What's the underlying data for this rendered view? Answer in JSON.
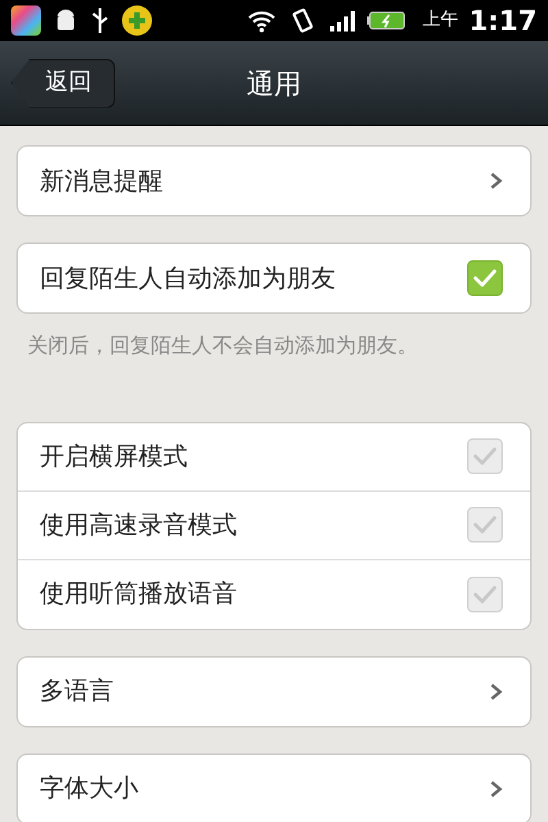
{
  "status_bar": {
    "time_period": "上午",
    "time": "1:17"
  },
  "nav_bar": {
    "back": "返回",
    "title": "通用"
  },
  "groups": [
    {
      "rows": [
        {
          "kind": "link",
          "label": "新消息提醒"
        }
      ]
    },
    {
      "rows": [
        {
          "kind": "checkbox",
          "label": "回复陌生人自动添加为朋友",
          "checked": true
        }
      ],
      "note": "关闭后，回复陌生人不会自动添加为朋友。"
    },
    {
      "rows": [
        {
          "kind": "checkbox",
          "label": "开启横屏模式",
          "checked": false
        },
        {
          "kind": "checkbox",
          "label": "使用高速录音模式",
          "checked": false
        },
        {
          "kind": "checkbox",
          "label": "使用听筒播放语音",
          "checked": false
        }
      ]
    },
    {
      "rows": [
        {
          "kind": "link",
          "label": "多语言"
        }
      ]
    },
    {
      "rows": [
        {
          "kind": "link",
          "label": "字体大小"
        }
      ]
    }
  ]
}
